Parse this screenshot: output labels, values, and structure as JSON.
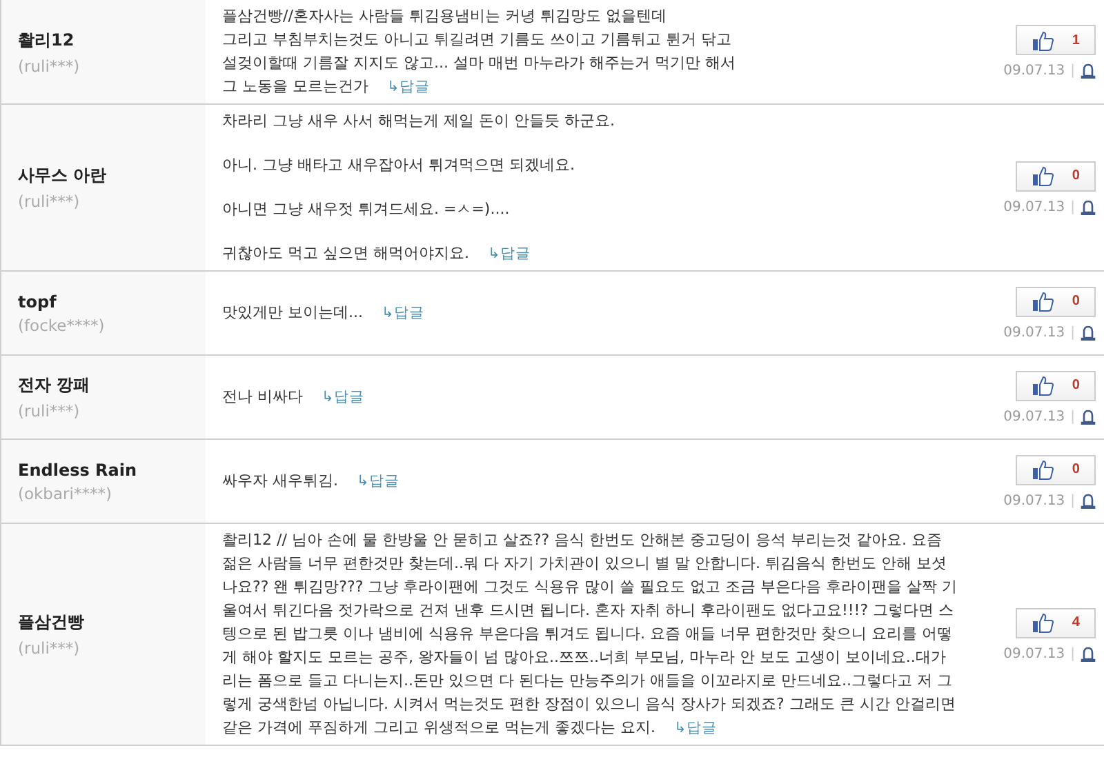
{
  "comments": [
    {
      "name": "촬리12",
      "user_id": "(ruli***)",
      "paragraphs": [
        [
          "플삼건빵//혼자사는 사람들 튀김용냄비는 커녕 튀김망도 없을텐데",
          "그리고 부침부치는것도 아니고 튀길려면 기름도 쓰이고 기름튀고 튄거 닦고",
          "설겆이할때 기름잘 지지도 않고... 설마 매번 마누라가 해주는거 먹기만 해서",
          "그 노동을 모르는건가"
        ]
      ],
      "reply": "↳답글",
      "likes": "1",
      "date": "09.07.13",
      "separator": "|"
    },
    {
      "name": "사무스 아란",
      "user_id": "(ruli***)",
      "paragraphs": [
        [
          "차라리 그냥 새우 사서 해먹는게 제일 돈이 안들듯 하군요."
        ],
        [
          "아니. 그냥 배타고 새우잡아서 튀겨먹으면 되겠네요."
        ],
        [
          "아니면 그냥 새우젓 튀겨드세요. =ㅅ=)...."
        ],
        [
          "귀찮아도 먹고 싶으면 해먹어야지요."
        ]
      ],
      "reply": "↳답글",
      "likes": "0",
      "date": "09.07.13",
      "separator": "|"
    },
    {
      "name": "topf",
      "user_id": "(focke****)",
      "paragraphs": [
        [
          "맛있게만 보이는데..."
        ]
      ],
      "reply": "↳답글",
      "likes": "0",
      "date": "09.07.13",
      "separator": "|"
    },
    {
      "name": "전자 깡패",
      "user_id": "(ruli***)",
      "paragraphs": [
        [
          "전나 비싸다"
        ]
      ],
      "reply": "↳답글",
      "likes": "0",
      "date": "09.07.13",
      "separator": "|"
    },
    {
      "name": "Endless Rain",
      "user_id": "(okbari****)",
      "paragraphs": [
        [
          "싸우자 새우튀김."
        ]
      ],
      "reply": "↳답글",
      "likes": "0",
      "date": "09.07.13",
      "separator": "|"
    },
    {
      "name": "플삼건빵",
      "user_id": "(ruli***)",
      "paragraphs": [
        [
          "촬리12 // 님아 손에 물 한방울 안 묻히고 살죠?? 음식 한번도 안해본 중고딩이 응석 부리는것 같아요. 요즘",
          "젊은 사람들 너무 편한것만 찾는데..뭐 다 자기 가치관이 있으니 별 말 안합니다. 튀김음식 한번도 안해 보셧",
          "나요?? 왠 튀김망??? 그냥 후라이팬에 그것도 식용유 많이 쓸 필요도 없고 조금 부은다음 후라이팬을 살짝 기",
          "울여서 튀긴다음 젓가락으로 건져 낸후 드시면 됩니다. 혼자 자취 하니 후라이팬도 없다고요!!!? 그렇다면 스",
          "텡으로 된 밥그릇 이나 냄비에 식용유 부은다음 튀겨도 됩니다. 요즘 애들 너무 편한것만 찾으니 요리를 어떻",
          "게 해야 할지도 모르는 공주, 왕자들이 넘 많아요..쯔쯔..너희 부모님, 마누라 안 보도 고생이 보이네요..대가",
          "리는 폼으로 들고 다니는지..돈만 있으면 다 된다는 만능주의가 애들을 이꼬라지로 만드네요..그렇다고 저 그",
          "렇게 궁색한넘 아닙니다. 시켜서 먹는것도 편한 장점이 있으니 음식 장사가 되겠죠? 그래도 큰 시간 안걸리면",
          "같은 가격에 푸짐하게 그리고 위생적으로 먹는게 좋겠다는 요지."
        ]
      ],
      "reply": "↳답글",
      "likes": "4",
      "date": "09.07.13",
      "separator": "|"
    }
  ]
}
